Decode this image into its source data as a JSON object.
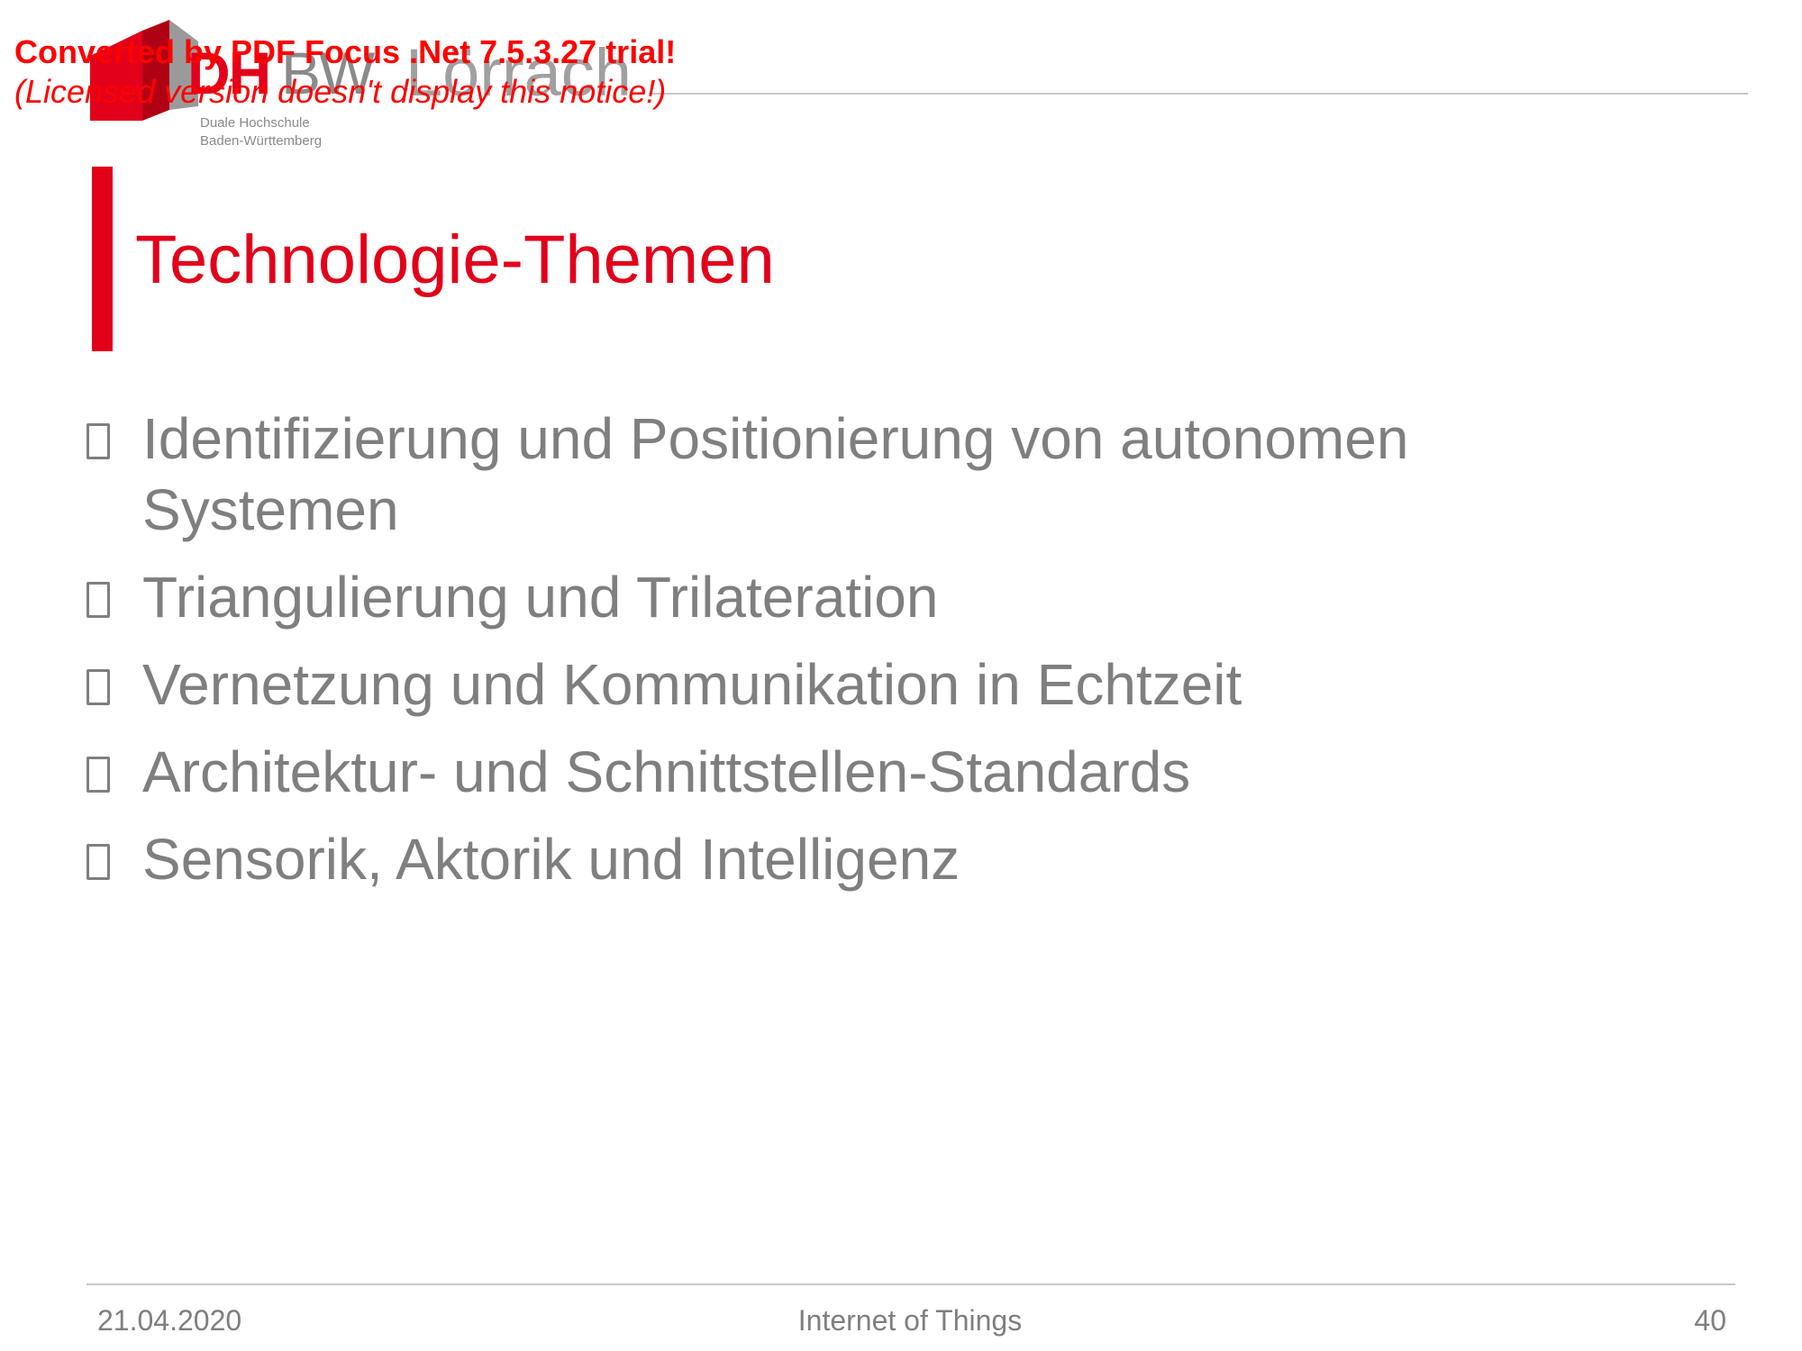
{
  "notice": {
    "line1": "Converted by PDF Focus .Net 7.5.3.27 trial!",
    "line2": "(Licensed version doesn't display this notice!)"
  },
  "logo": {
    "dh": "DH",
    "bw": "BW",
    "city": "Lörrach",
    "subtitle_line1": "Duale Hochschule",
    "subtitle_line2": "Baden-Württemberg",
    "brand_color": "#e2001a",
    "gray_color": "#8a8a8a"
  },
  "slide": {
    "title": "Technologie-Themen",
    "title_color": "#e2001a",
    "text_color": "#7f7f7f",
    "bullets": [
      {
        "text": "Identifizierung und Positionierung von autonomen Systemen"
      },
      {
        "text": "Triangulierung und Trilateration"
      },
      {
        "text": "Vernetzung und Kommunikation in Echtzeit"
      },
      {
        "text": "Architektur- und Schnittstellen-Standards"
      },
      {
        "text": "Sensorik, Aktorik und Intelligenz"
      }
    ]
  },
  "footer": {
    "date": "21.04.2020",
    "title": "Internet of Things",
    "page_number": "40"
  }
}
